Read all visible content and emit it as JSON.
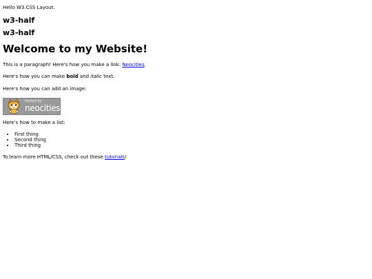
{
  "hello": "Hello W3.CSS Layout.",
  "halves": [
    {
      "label": "w3-half"
    },
    {
      "label": "w3-half"
    }
  ],
  "main_title": "Welcome to my Website!",
  "paragraph_link": {
    "prefix": "This is a paragraph! Here's how you make a link: ",
    "link_text": "Neocities",
    "suffix": "."
  },
  "paragraph_format": {
    "prefix": "Here's how you can make ",
    "bold_text": "bold",
    "middle": " and ",
    "italic_text": "italic",
    "suffix": " text."
  },
  "paragraph_image": "Here's how you can add an image:",
  "badge": {
    "small_text": "hosted by",
    "big_text": "neocities",
    "background_color": "#9a9a9a"
  },
  "paragraph_list": "Here's how to make a list:",
  "list_items": [
    {
      "label": "First thing"
    },
    {
      "label": "Second thing"
    },
    {
      "label": "Third thing"
    }
  ],
  "paragraph_learn": {
    "prefix": "To learn more HTML/CSS, check out these ",
    "link_text": "tutorials",
    "suffix": "!"
  },
  "colors": {
    "link": "#0000ee",
    "text": "#000000",
    "background": "#ffffff"
  }
}
